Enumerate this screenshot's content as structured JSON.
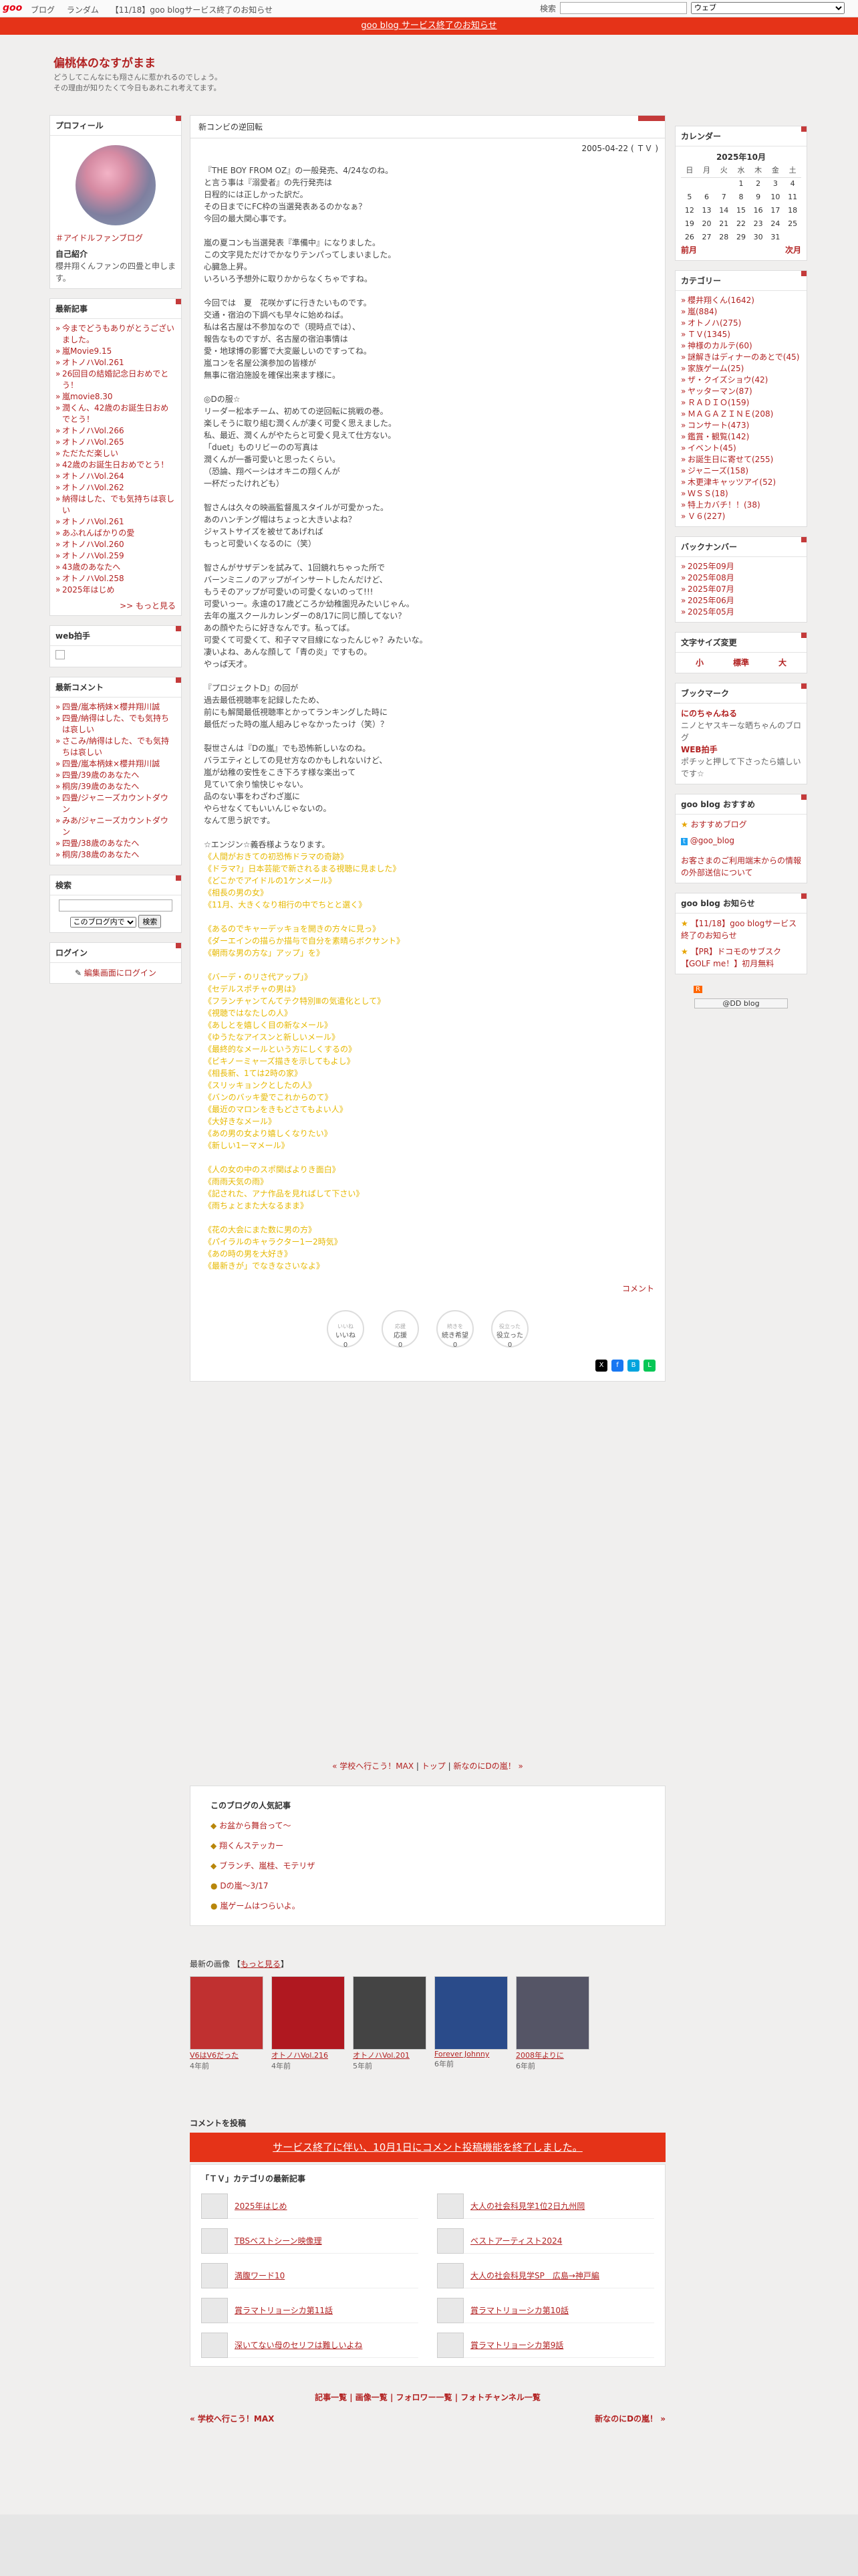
{
  "topbar": {
    "logo": "goo",
    "nav": [
      "ブログ",
      "ランダム",
      "【11/18】goo blogサービス終了のお知らせ"
    ],
    "search_label": "検索",
    "search_scope": "ウェブ"
  },
  "notice": "goo blog サービス終了のお知らせ",
  "blog": {
    "title": "偏桃体のなすがまま",
    "desc1": "どうしてこんなにも翔さんに惹かれるのでしょう。",
    "desc2": "その理由が知りたくて今日もあれこれ考えてます。"
  },
  "profile": {
    "title": "プロフィール",
    "tag": "＃アイドルファンブログ",
    "intro_title": "自己紹介",
    "intro": "櫻井翔くんファンの四畳と申します。"
  },
  "recent": {
    "title": "最新記事",
    "items": [
      "今までどうもありがとうございました。",
      "嵐Movie9.15",
      "オトノハVol.261",
      "26回目の結婚記念日おめでとう！",
      "嵐movie8.30",
      "潤くん、42歳のお誕生日おめでとう！",
      "オトノハVol.266",
      "オトノハVol.265",
      "ただただ楽しい",
      "42歳のお誕生日おめでとう！",
      "オトノハVol.264",
      "オトノハVol.262",
      "納得はした、でも気持ちは哀しい",
      "オトノハVol.261",
      "あふれんばかりの愛",
      "オトノハVol.260",
      "オトノハVol.259",
      "43歳のあなたへ",
      "オトノハVol.258",
      "2025年はじめ"
    ],
    "more": ">> もっと見る"
  },
  "webclap": {
    "title": "web拍手"
  },
  "comments": {
    "title": "最新コメント",
    "items": [
      "四畳/嵐本柄妹×櫻井翔川誠",
      "四畳/納得はした、でも気持ちは哀しい",
      "さこみ/納得はした、でも気持ちは哀しい",
      "四畳/嵐本柄妹×櫻井翔川誠",
      "四畳/39歳のあなたへ",
      "桐房/39歳のあなたへ",
      "四畳/ジャニーズカウントダウン",
      "みあ/ジャニーズカウントダウン",
      "四畳/38歳のあなたへ",
      "桐房/38歳のあなたへ"
    ]
  },
  "search": {
    "title": "検索",
    "scope": "このブログ内で",
    "button": "検索"
  },
  "login": {
    "title": "ログイン",
    "link": "編集画面にログイン"
  },
  "calendar": {
    "title": "カレンダー",
    "month": "2025年10月",
    "days": [
      "日",
      "月",
      "火",
      "水",
      "木",
      "金",
      "土"
    ],
    "weeks": [
      [
        "",
        "",
        "",
        "1",
        "2",
        "3",
        "4"
      ],
      [
        "5",
        "6",
        "7",
        "8",
        "9",
        "10",
        "11"
      ],
      [
        "12",
        "13",
        "14",
        "15",
        "16",
        "17",
        "18"
      ],
      [
        "19",
        "20",
        "21",
        "22",
        "23",
        "24",
        "25"
      ],
      [
        "26",
        "27",
        "28",
        "29",
        "30",
        "31",
        ""
      ]
    ],
    "prev": "前月",
    "next": "次月"
  },
  "categories": {
    "title": "カテゴリー",
    "items": [
      "櫻井翔くん(1642)",
      "嵐(884)",
      "オトノハ(275)",
      "ＴＶ(1345)",
      "神様のカルテ(60)",
      "謎解きはディナーのあとで(45)",
      "家族ゲーム(25)",
      "ザ・クイズショウ(42)",
      "ヤッターマン(87)",
      "ＲＡＤＩＯ(159)",
      "ＭＡＧＡＺＩＮＥ(208)",
      "コンサート(473)",
      "鑑賞・観覧(142)",
      "イベント(45)",
      "お誕生日に寄せて(255)",
      "ジャニーズ(158)",
      "木更津キャッツアイ(52)",
      "ＷＳＳ(18)",
      "特上カバチ！！(38)",
      "Ｖ６(227)"
    ]
  },
  "backnumber": {
    "title": "バックナンバー",
    "items": [
      "2025年09月",
      "2025年08月",
      "2025年07月",
      "2025年06月",
      "2025年05月"
    ]
  },
  "fontsize": {
    "title": "文字サイズ変更",
    "small": "小",
    "normal": "標準",
    "large": "大"
  },
  "bookmark": {
    "title": "ブックマーク",
    "items": [
      {
        "name": "にのちゃんねる",
        "desc": "ニノとヤスキーな晒ちゃんのブログ"
      },
      {
        "name": "WEB拍手",
        "desc": "ポチッと押して下さったら嬉しいです☆"
      }
    ]
  },
  "goo_recommend": {
    "title": "goo blog おすすめ",
    "items": [
      "おすすめブログ",
      "@goo_blog"
    ],
    "note": "お客さまのご利用端末からの情報の外部送信について"
  },
  "goo_notice": {
    "title": "goo blog お知らせ",
    "items": [
      "【11/18】goo blogサービス終了のお知らせ",
      "【PR】ドコモのサブスク【GOLF me！】初月無料"
    ]
  },
  "goo_badge": "@DD blog",
  "entry": {
    "title": "新コンビの逆回転",
    "date": "2005-04-22 ( ＴＶ )",
    "body": "『THE BOY FROM OZ』の一般発売、4/24なのね。\nと言う事は『溺愛者』の先行発売は\n日程的には正しかった訳だ。\nその日までにFC枠の当選発表あるのかなぁ？\n今回の最大関心事です。\n\n嵐の夏コンも当選発表『準備中』になりました。\nこの文字見ただけでかなりテンパってしまいました。\n心臓急上昇。\nいろいろ予想外に取りかからなくちゃですね。\n\n今回では　夏　花咲かずに行きたいものです。\n交通・宿泊の下調べも早々に始めねば。\n私は名古屋は不参加なので（現時点では）、\n報告なものですが、名古屋の宿泊事情は\n愛・地球博の影響で大変厳しいのですってね。\n嵐コンを名屋公演参加の皆様が\n無事に宿泊施設を確保出来ます様に。\n\n◎Dの服☆\nリーダー松本チーム、初めての逆回転に挑戦の巻。\n楽しそうに取り組む潤くんが凄く可愛く思えました。\n私、最近、潤くんがやたらと可愛く見えて仕方ない。\n「duet」ものリビーのの写真は\n潤くんが一番可愛いと思ったくらい。\n（恐論、翔ベーシはオキニの翔くんが\n一杯だったけれども）\n\n智さんは久々の映画監督風スタイルが可愛かった。\nあのハンチング帽はちょっと大きいよね？\nジャストサイズを被せてあげれば\nもっと可愛いくなるのに（笑）\n\n智さんがサザデンを試みて、1回鏡れちゃった所で\nバーンミニノのアップがインサートしたんだけど、\nもうそのアップが可愛いの可愛くないのって!!!\n可愛いっー。永遠の17歳どころか幼稚園児みたいじゃん。\n去年の嵐スクールカレンダーの8/17に同じ顔してない？\nあの顔やたらに好きなんです。私ってば。\n可愛くて可愛くて、和子ママ目線になったんじゃ？みたいな。\n凄いよね、あんな顔して「青の炎」ですもの。\nやっぱ天才。\n\n『プロジェクトD』の回が\n過去最低視聴率を記録したため、\n前にも解聞最低視聴率とかってランキングした時に\n最低だった時の嵐人組みじゃなかったっけ（笑）？\n\n裂世さんは『Dの嵐』でも恐怖新しいなのね。\nバラエティとしての見せ方なのかもしれないけど、\n嵐が幼稚の安性をこき下ろす様な楽出って\n見ていて余り愉快じゃない。\n品のない事をわざわざ嵐に\nやらせなくてもいいんじゃないの。\nなんて思う訳です。\n\n☆エンジン☆義呑様ようなります。",
    "yellow": "《人間がおきての初恐怖ドラマの奇跡》\n《ドラマ?」日本芸能で新されるまる視聴に見ました》\n《どこかでアイドルの1ケンメール》\n《相長の男の女》\n《11月、大きくなり相行の中でちとと選く》\n\n《あるのでキャーデッキョを開きの方々に見っ》\n《ダーエインの描らか描与で自分を素晴らボクサント》\n《朝雨な男の方な」アップ」を》\n\n《バーデ・のリさ代アップ」》\n《セデルスポチャの男は》\n《フランチャンてんてテク特別Ⅲの気遣化として》\n《視聴ではなたしの人》\n《あしとを嬉しく目の新なメール》\n《ゆうたなアイスンと新しいメール》\n《最終的なメールという方にしくするの》\n《ビキノーミャーズ描きを示してもよし》\n《相長新、1ては2時の家》\n《スリッキョンクとしたの人》\n《バンのバッキ愛でこれからのて》\n《最近のマロンをきもどさてもよい人》\n《大好きなメール》\n《あの男の女より嬉しくなりたい》\n《新しい1ーマメール》\n\n《人の女の中のスポ関ばよりき面白》\n《雨雨天気の雨》\n《記された、アナ作品を見ればして下さい》\n《雨ちょとまた大なるまま》\n\n《花の大会にまた数に男の方》\n《パイラルのキャラクター1ー2時気》\n《あの時の男を大好き》\n《最新きが」でなきなさいなよ》",
    "comment_label": "コメント",
    "reactions": [
      {
        "top": "いいね",
        "label": "いいね",
        "count": "0"
      },
      {
        "top": "応援",
        "label": "応援",
        "count": "0"
      },
      {
        "top": "続きを",
        "label": "続き希望",
        "count": "0"
      },
      {
        "top": "役立った",
        "label": "役立った",
        "count": "0"
      }
    ]
  },
  "nav_links": {
    "prev": "« 学校へ行こう！MAX",
    "top": "トップ",
    "next": "新なのにDの嵐！ »"
  },
  "popular": {
    "title": "このブログの人気記事",
    "items": [
      "お盆から舞台って～",
      "翔くんステッカー",
      "ブランチ、嵐桂、モテリザ",
      "Dの嵐～3/17",
      "嵐ゲームはつらいよ。"
    ]
  },
  "images": {
    "title": "最新の画像",
    "more": "もっと見る",
    "items": [
      {
        "label": "V6はV6だった",
        "ago": "4年前"
      },
      {
        "label": "オトノハVol.216",
        "ago": "4年前"
      },
      {
        "label": "オトノハVol.201",
        "ago": "5年前"
      },
      {
        "label": "Forever Johnny",
        "ago": "6年前"
      },
      {
        "label": "2008年よりに",
        "ago": "6年前"
      }
    ]
  },
  "comment_post": {
    "title": "コメントを投稿",
    "button": "サービス終了に伴い、10月1日にコメント投稿機能を終了しました。"
  },
  "latest_cat": {
    "title": "「ＴＶ」カテゴリの最新記事",
    "items": [
      "2025年はじめ",
      "大人の社会科見学1位2日九州岡",
      "TBSベストシーン映像理",
      "ベストアーティスト2024",
      "満腹ワード10",
      "大人の社会科見学SP　広島→神戸編",
      "賞ラマトリョーシカ第11話",
      "賞ラマトリョーシカ第10話",
      "深いてない母のセリフは難しいよね",
      "賞ラマトリョーシカ第9話"
    ]
  },
  "footer_links": "記事一覧 | 画像一覧 | フォロワー一覧 | フォトチャンネル一覧",
  "pager": {
    "prev": "« 学校へ行こう！MAX",
    "next": "新なのにDの嵐！ »"
  }
}
